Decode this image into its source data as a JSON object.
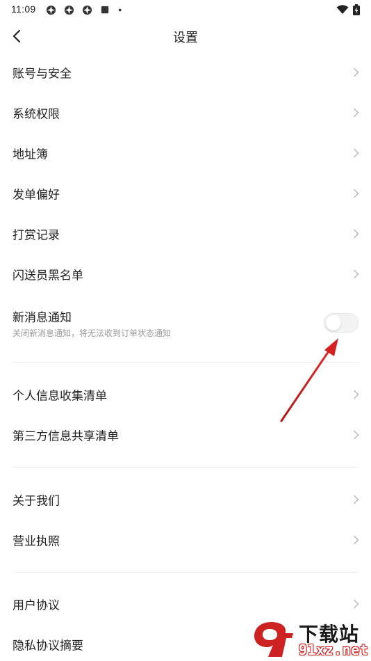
{
  "status_bar": {
    "time": "11:09",
    "icons": [
      "app-icon",
      "app-icon",
      "app-icon",
      "square-icon",
      "dot-icon"
    ],
    "right_icons": [
      "wifi-icon",
      "battery-charging-icon"
    ]
  },
  "nav": {
    "title": "设置",
    "back_icon": "chevron-left-icon"
  },
  "settings": {
    "account_security": "账号与安全",
    "system_permissions": "系统权限",
    "address_book": "地址簿",
    "order_preferences": "发单偏好",
    "tip_records": "打赏记录",
    "courier_blacklist": "闪送员黑名单",
    "notifications": {
      "label": "新消息通知",
      "description": "关闭新消息通知，将无法收到订单状态通知",
      "enabled": false
    },
    "personal_info_list": "个人信息收集清单",
    "third_party_list": "第三方信息共享清单",
    "about_us": "关于我们",
    "business_license": "营业执照",
    "user_agreement": "用户协议",
    "privacy_summary": "隐私协议摘要"
  },
  "watermark": {
    "title": "下载站",
    "url": "91xz.net",
    "logo_text": "9f"
  },
  "colors": {
    "text_primary": "#222222",
    "text_secondary": "#9a9a9a",
    "divider": "#ececec",
    "chevron": "#b8b8b8",
    "annotation_arrow": "#d42020",
    "watermark_red": "#cc2222"
  }
}
